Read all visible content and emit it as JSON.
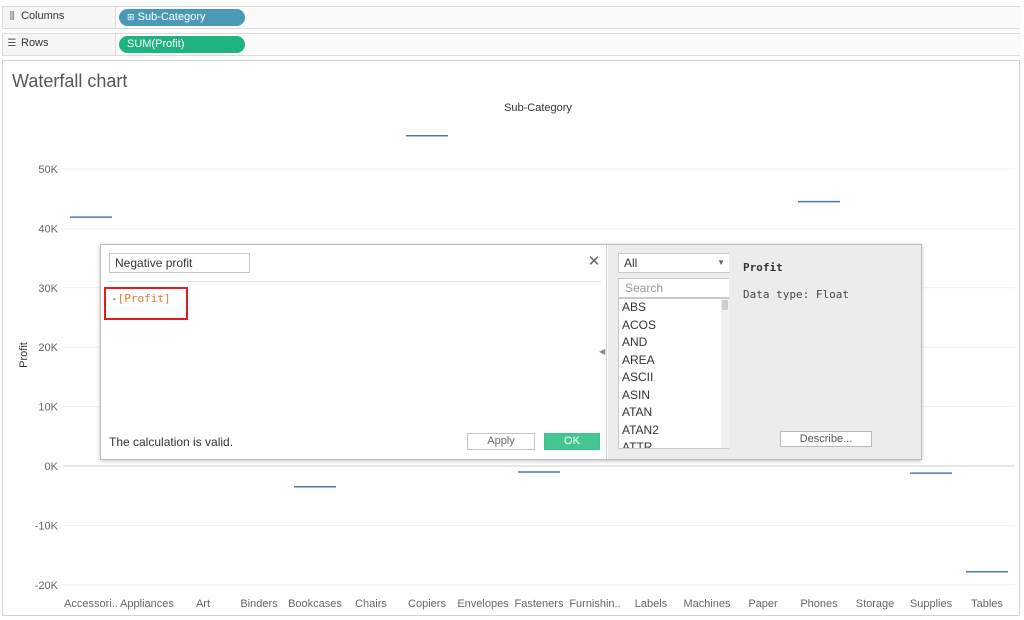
{
  "shelves": {
    "columns": {
      "label": "Columns",
      "icon": "columns-icon",
      "pill": "Sub-Category"
    },
    "rows": {
      "label": "Rows",
      "icon": "rows-icon",
      "pill": "SUM(Profit)"
    }
  },
  "sheet": {
    "title": "Waterfall chart"
  },
  "colors": {
    "dimension_pill": "#4a9ab7",
    "measure_pill": "#1fb47f",
    "mark_line": "#4f79a8",
    "ok_button": "#45c690",
    "highlight_box": "#e11d1d"
  },
  "chart_data": {
    "type": "waterfall",
    "title": "Sub-Category",
    "xlabel": "",
    "ylabel": "Profit",
    "yticks": [
      "50K",
      "40K",
      "30K",
      "20K",
      "10K",
      "0K",
      "-10K",
      "-20K"
    ],
    "ytick_values": [
      50000,
      40000,
      30000,
      20000,
      10000,
      0,
      -10000,
      -20000
    ],
    "ylim": [
      -20000,
      60000
    ],
    "grid": true,
    "categories": [
      "Accessori..",
      "Appliances",
      "Art",
      "Binders",
      "Bookcases",
      "Chairs",
      "Copiers",
      "Envelopes",
      "Fasteners",
      "Furnishin..",
      "Labels",
      "Machines",
      "Paper",
      "Phones",
      "Storage",
      "Supplies",
      "Tables"
    ],
    "values": [
      41900,
      null,
      null,
      null,
      -3500,
      null,
      55600,
      null,
      -1000,
      null,
      null,
      null,
      null,
      44500,
      null,
      -1200,
      -17800
    ]
  },
  "dialog": {
    "calc_name": "Negative profit",
    "close_glyph": "✕",
    "formula_op": "-",
    "formula_field": "[Profit]",
    "status": "The calculation is valid.",
    "apply_label": "Apply",
    "ok_label": "OK",
    "function_filter": "All",
    "search_placeholder": "Search",
    "functions": [
      "ABS",
      "ACOS",
      "AND",
      "AREA",
      "ASCII",
      "ASIN",
      "ATAN",
      "ATAN2",
      "ATTR"
    ],
    "help_title": "Profit",
    "help_type": "Data type: Float",
    "describe_label": "Describe..."
  }
}
